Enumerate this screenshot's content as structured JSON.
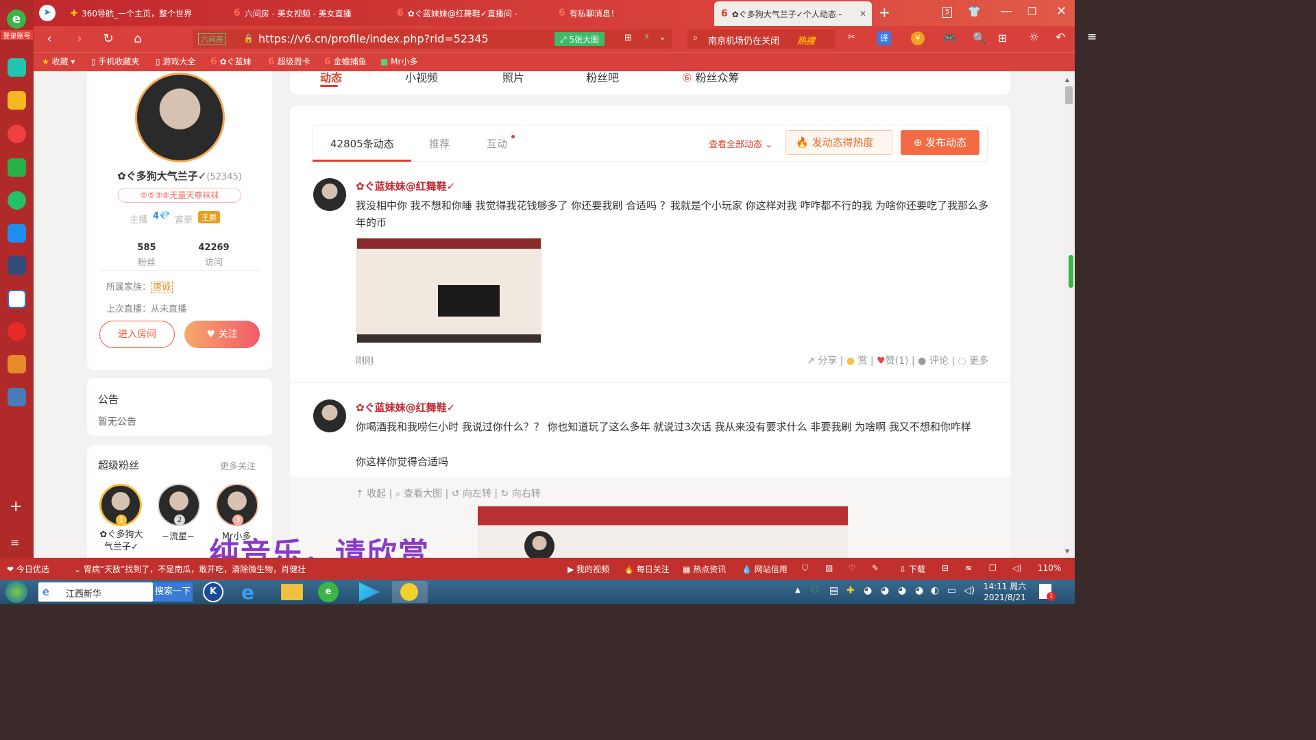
{
  "browser": {
    "login_label": "登录账号",
    "tabs": [
      {
        "label": "360导航_一个主页，整个世界"
      },
      {
        "label": "六间房 - 美女视频 - 美女直播"
      },
      {
        "label": "✿ぐ蓝妹妹@红舞鞋✓直播间 -"
      },
      {
        "label": "有私聊消息！"
      },
      {
        "label": "✿ぐ多狗大气兰子✓个人动态 -"
      }
    ],
    "tab_count": "5",
    "url": "https://v6.cn/profile/index.php?rid=52345",
    "url_badge": "六间房",
    "big_image_label": "5张大图",
    "search_text": "南京机场仍在关闭",
    "hot_label": "热搜",
    "translate_label": "译",
    "bookmarks": [
      "收藏",
      "手机收藏夹",
      "游戏大全",
      "✿ぐ蓝妹",
      "超级周卡",
      "金蟾捕鱼",
      "Mr小多"
    ]
  },
  "page": {
    "nav_tabs": [
      "动态",
      "小视频",
      "照片",
      "粉丝吧",
      "粉丝众筹"
    ],
    "profile": {
      "name": "✿ぐ多狗大气兰子✓",
      "rid": "(52345)",
      "badge": "⑥⑤⑨⑧无量天尊袜袜",
      "host_label": "主播",
      "host_level": "4",
      "rich_label": "富豪",
      "rich_level": "王爵",
      "fans_count": "585",
      "fans_label": "粉丝",
      "visits_count": "42269",
      "visits_label": "访问",
      "family_label": "所属家族：",
      "family_value": "唐诚",
      "last_live": "上次直播：从未直播",
      "enter_room": "进入房间",
      "follow": "关注"
    },
    "notice": {
      "title": "公告",
      "text": "暂无公告"
    },
    "super_fans": {
      "title": "超级粉丝",
      "more": "更多关注",
      "fans": [
        {
          "rank": "1",
          "name": "✿ぐ多狗大气兰子✓"
        },
        {
          "rank": "2",
          "name": "~流星~"
        },
        {
          "rank": "3",
          "name": "Mr小多"
        }
      ]
    },
    "feed_tabs": {
      "count_tab": "42805条动态",
      "recommend": "推荐",
      "interact": "互动",
      "view_all": "查看全部动态",
      "hot_btn": "发动态得热度",
      "publish_btn": "发布动态"
    },
    "posts": [
      {
        "author": "✿ぐ蓝妹妹@红舞鞋✓",
        "text": "我没相中你 我不想和你睡 我觉得我花钱够多了 你还要我刷 合适吗 ？我就是个小玩家 你这样对我 咋咋都不行的我 为啥你还要吃了我那么多年的币",
        "time": "刚刚",
        "actions": {
          "share": "分享",
          "reward": "赏",
          "like": "赞(1)",
          "comment": "评论",
          "more": "更多"
        }
      },
      {
        "author": "✿ぐ蓝妹妹@红舞鞋✓",
        "text": "你喝酒我和我唠仨小时 我说过你什么？？ 你也知道玩了这么多年 就说过3次话 我从来没有要求什么 非要我刷 为啥啊 我又不想和你咋样",
        "text2": "你这样你觉得合适吗",
        "tools": {
          "collapse": "收起",
          "view_big": "查看大图",
          "rotate_left": "向左转",
          "rotate_right": "向右转"
        }
      }
    ],
    "overlay_caption": "纯音乐，请欣赏"
  },
  "statusbar": {
    "left": "今日优选",
    "news": "胃病“天敌”找到了，不是南瓜，敢开吃，清除微生物，肖健壮",
    "items": [
      "我的视频",
      "每日关注",
      "热点资讯",
      "网站信用",
      "下载"
    ],
    "zoom": "110%"
  },
  "taskbar": {
    "search_placeholder": "江西新华",
    "search_button": "搜索一下",
    "time": "14:11 周六",
    "date": "2021/8/21",
    "notify_count": "1"
  },
  "colors": {
    "brand": "#d8413b",
    "accent": "#f36b44",
    "link_red": "#c0282d"
  }
}
